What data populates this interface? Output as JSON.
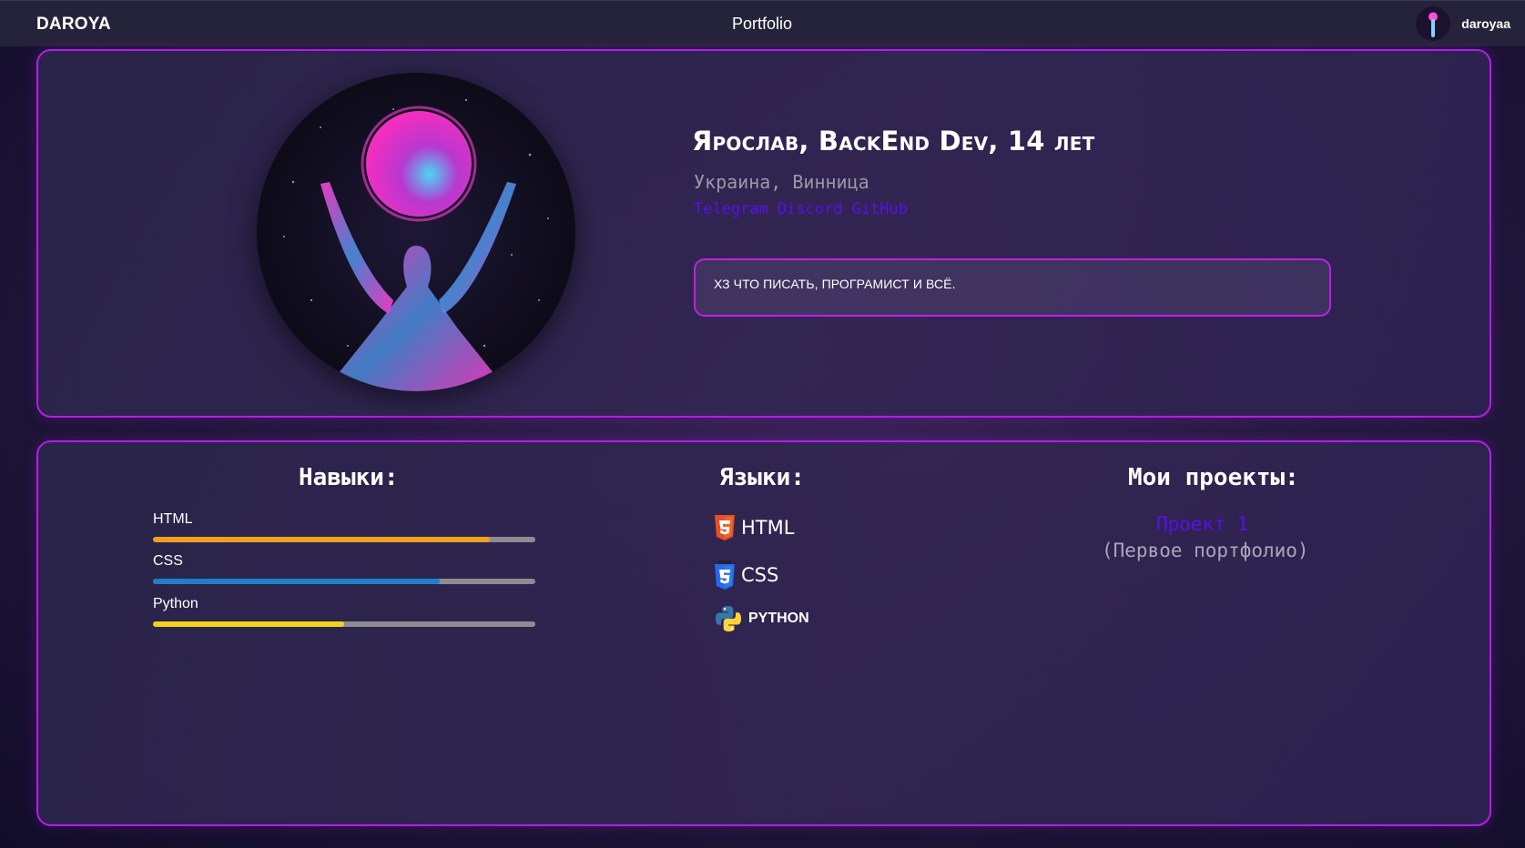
{
  "header": {
    "brand": "DAROYA",
    "title": "Portfolio",
    "username": "daroyaa"
  },
  "profile": {
    "name": "Ярослав, BackEnd Dev, 14 лет",
    "location": "Украина, Винница",
    "links": [
      "Telegram",
      "Discord",
      "GitHub"
    ],
    "about": "ХЗ ЧТО ПИСАТЬ, ПРОГРАМИСТ И ВСЁ."
  },
  "skills": {
    "title": "Навыки:",
    "items": [
      {
        "label": "HTML",
        "level": 0.88,
        "color": "#f0a020"
      },
      {
        "label": "CSS",
        "level": 0.75,
        "color": "#1f7fc8"
      },
      {
        "label": "Python",
        "level": 0.5,
        "color": "#f2d21a"
      }
    ]
  },
  "languages": {
    "title": "Языки:",
    "items": [
      {
        "label": "HTML",
        "icon": "html5-icon",
        "color": "#e34f26"
      },
      {
        "label": "CSS",
        "icon": "css3-icon",
        "color": "#2965f1"
      },
      {
        "label": "PYTHON",
        "icon": "python-icon",
        "color": "#3776ab"
      }
    ]
  },
  "projects": {
    "title": "Мои проекты:",
    "items": [
      {
        "label": "Проект 1",
        "description": "(Первое портфолио)"
      }
    ]
  }
}
